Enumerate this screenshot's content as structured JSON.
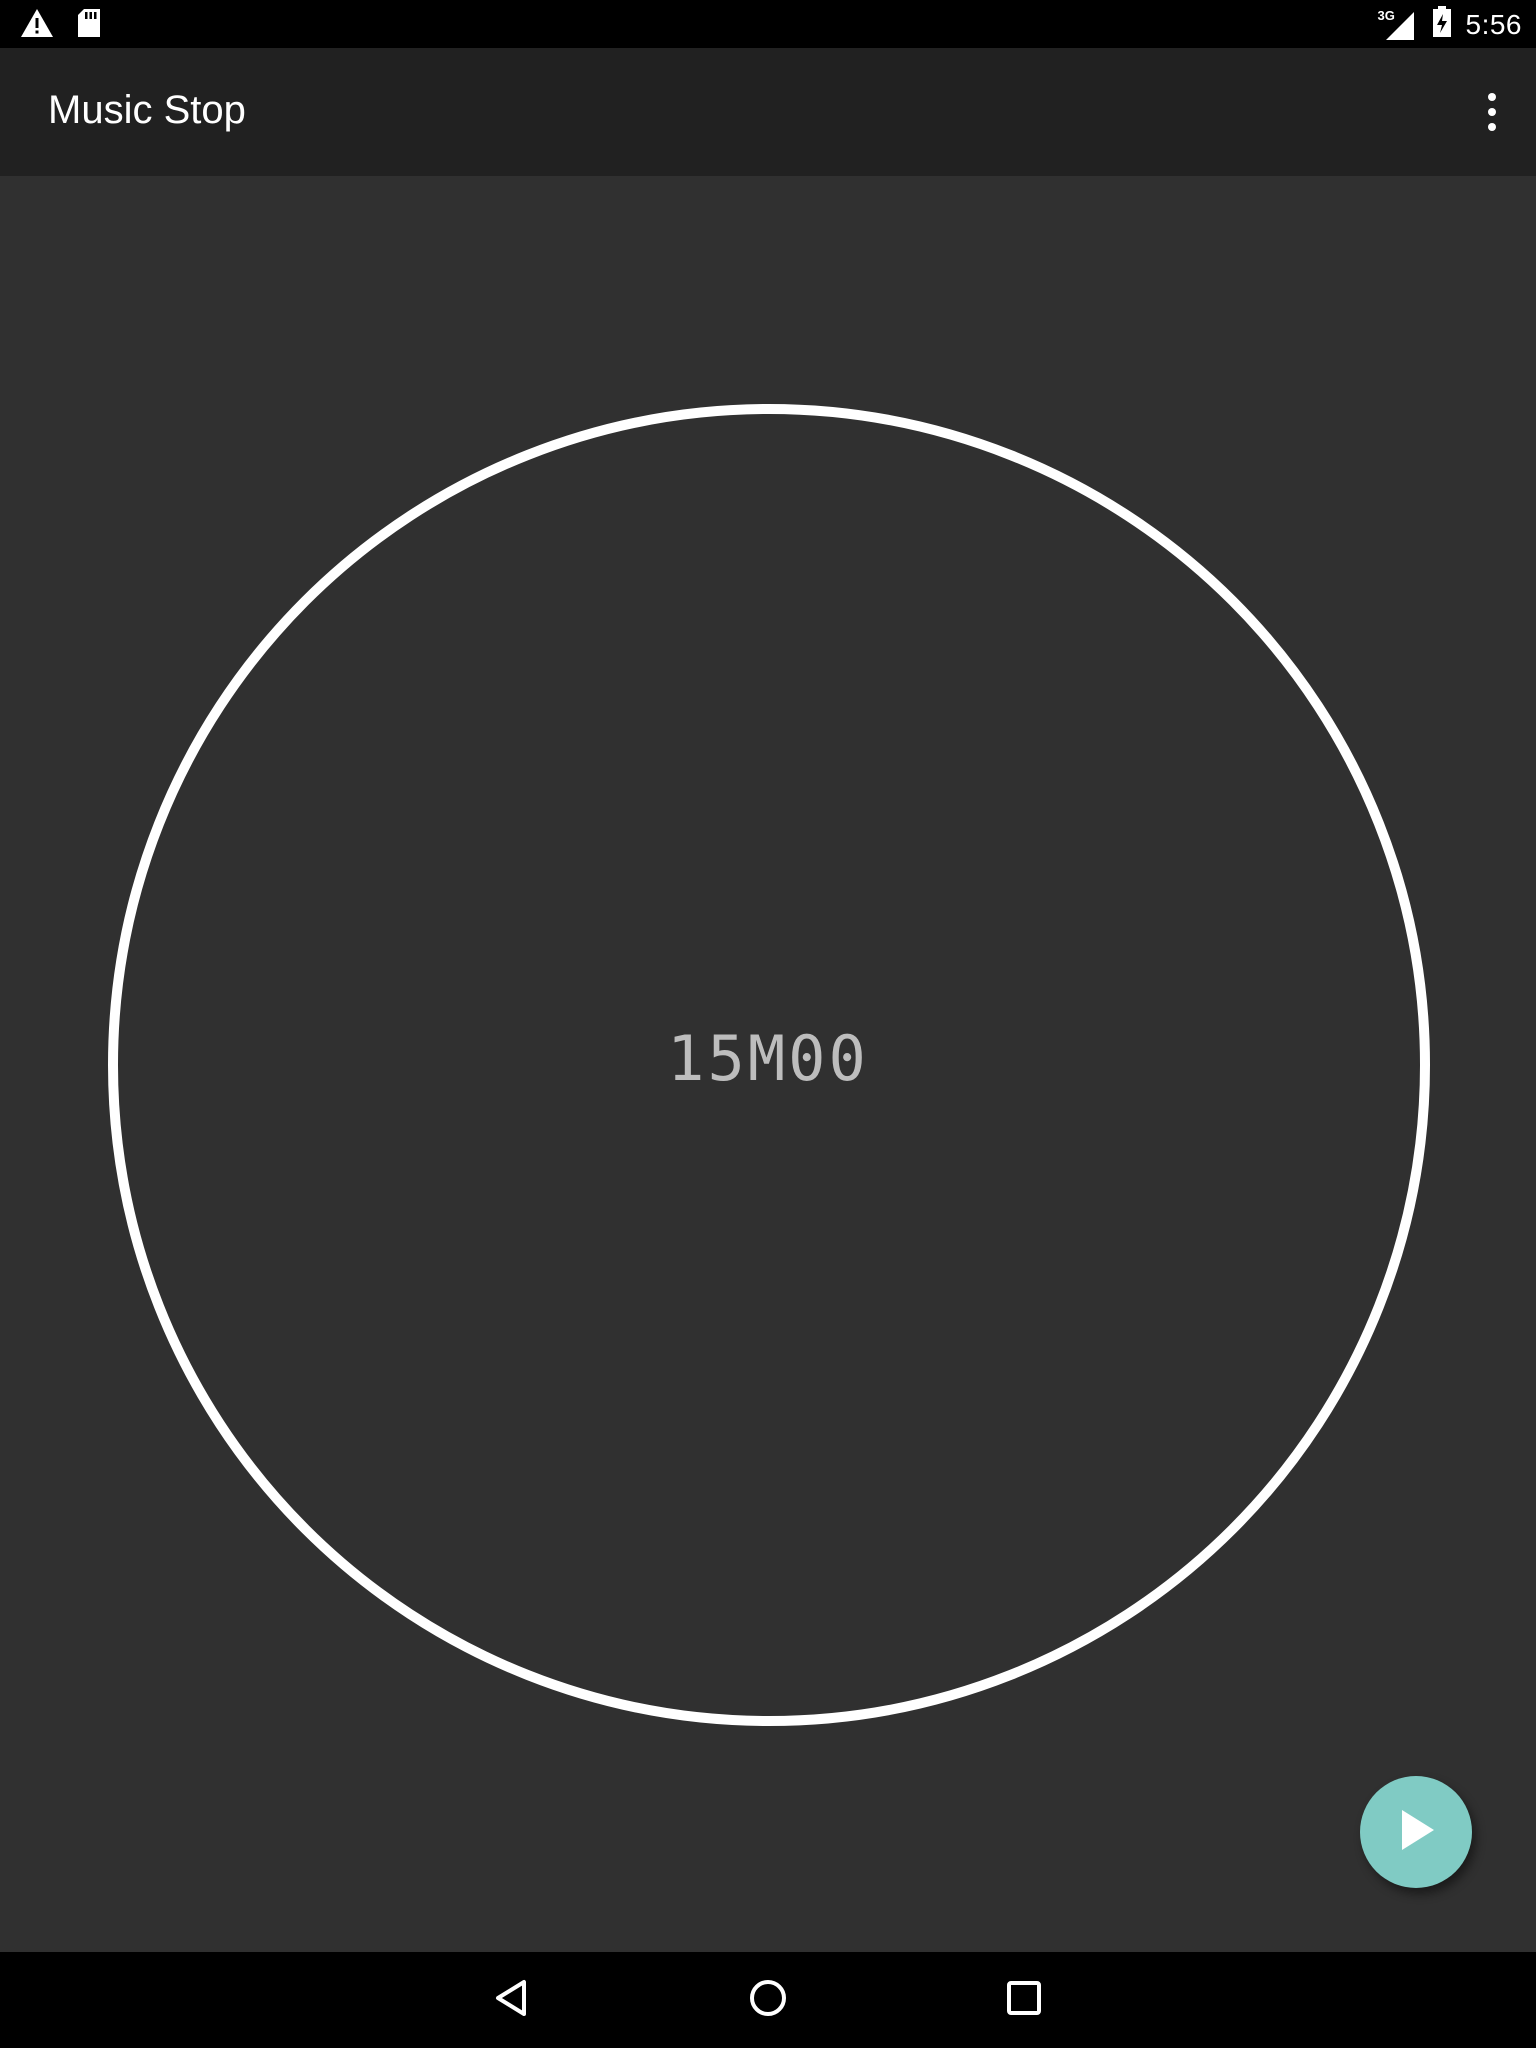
{
  "status_bar": {
    "time": "5:56",
    "network": "3G",
    "left_icons": [
      "warning-icon",
      "sd-card-icon"
    ],
    "right_icons": [
      "signal-icon",
      "battery-charging-icon"
    ]
  },
  "app_bar": {
    "title": "Music Stop",
    "menu_icon": "overflow-menu-icon"
  },
  "timer": {
    "display": "15M00",
    "ring_color": "#ffffff"
  },
  "fab": {
    "icon": "play-icon",
    "color": "#80cbc4"
  },
  "nav_bar": {
    "buttons": [
      "back-icon",
      "home-icon",
      "recents-icon"
    ]
  },
  "colors": {
    "background": "#303030",
    "app_bar": "#212121",
    "status_bar": "#000000",
    "accent": "#80cbc4"
  }
}
